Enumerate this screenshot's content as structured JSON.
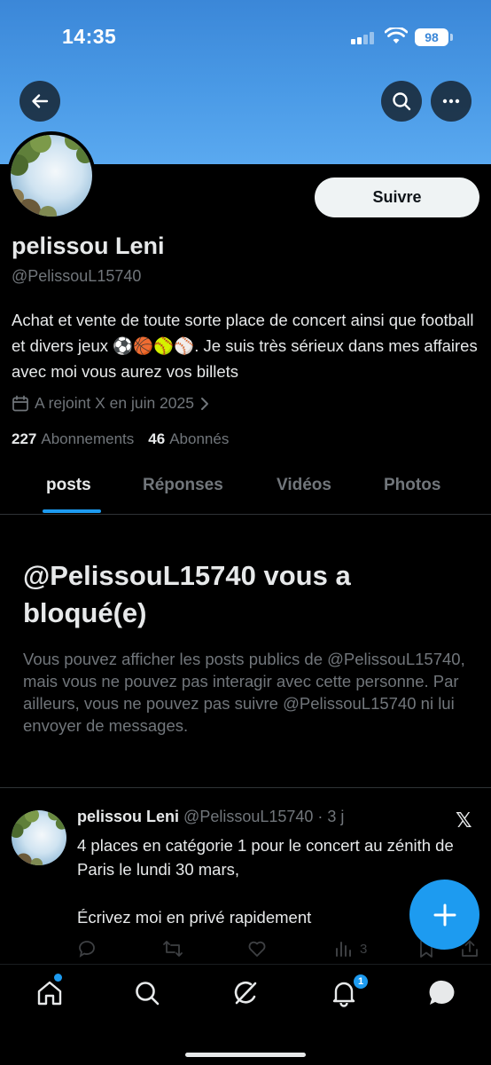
{
  "status_bar": {
    "time": "14:35",
    "battery": "98"
  },
  "profile": {
    "display_name": "pelissou Leni",
    "handle": "@PelissouL15740",
    "bio": "Achat et vente de toute sorte place de concert ainsi que football et divers jeux ⚽🏀🥎⚾. Je suis très sérieux dans mes affaires avec moi vous aurez vos billets",
    "joined": "A rejoint X en juin 2025",
    "following_count": "227",
    "following_label": "Abonnements",
    "followers_count": "46",
    "followers_label": "Abonnés",
    "follow_label": "Suivre"
  },
  "tabs": [
    {
      "label": "posts",
      "active": true
    },
    {
      "label": "Réponses",
      "active": false
    },
    {
      "label": "Vidéos",
      "active": false
    },
    {
      "label": "Photos",
      "active": false
    }
  ],
  "blocked": {
    "title": "@PelissouL15740 vous a bloqué(e)",
    "body": "Vous pouvez afficher les posts publics de @PelissouL15740, mais vous ne pouvez pas interagir avec cette personne. Par ailleurs, vous ne pouvez pas suivre @PelissouL15740 ni lui envoyer de messages."
  },
  "post": {
    "author": "pelissou Leni",
    "handle": "@PelissouL15740",
    "separator": " · ",
    "time": "3 j",
    "text": "4 places en catégorie 1 pour le concert au zénith de Paris le lundi 30 mars,\n\nÉcrivez moi en privé rapidement",
    "views": "3"
  },
  "nav": {
    "notifications_badge": "1"
  },
  "colors": {
    "accent": "#1d9bf0",
    "banner": "#4a9ae6",
    "background": "#000000",
    "muted": "#71767b"
  },
  "icons": [
    "back-arrow-icon",
    "search-icon",
    "more-icon",
    "calendar-icon",
    "chevron-right-icon",
    "x-logo-icon",
    "reply-icon",
    "repost-icon",
    "like-icon",
    "views-icon",
    "bookmark-icon",
    "share-icon",
    "compose-plus-icon",
    "home-icon",
    "explore-icon",
    "grok-icon",
    "bell-icon",
    "messages-icon"
  ]
}
